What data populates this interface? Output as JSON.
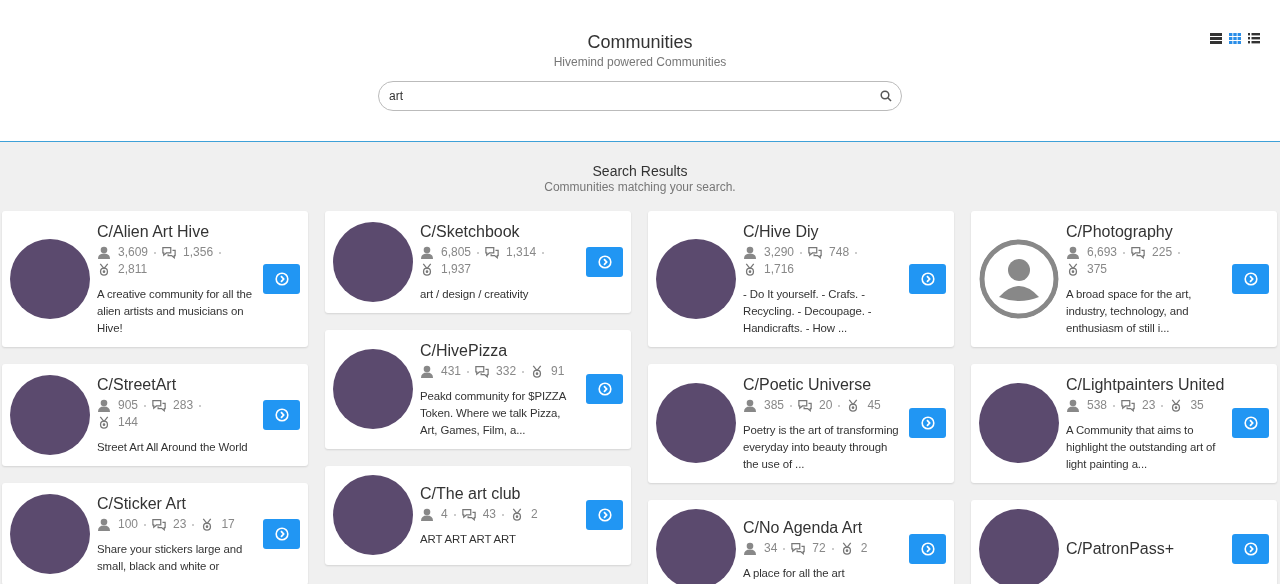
{
  "header": {
    "title": "Communities",
    "subtitle": "Hivemind powered Communities",
    "search": {
      "value": "art"
    },
    "view_modes": [
      {
        "kind": "rows",
        "selected": false
      },
      {
        "kind": "grid",
        "selected": true
      },
      {
        "kind": "list",
        "selected": false
      }
    ]
  },
  "results": {
    "title": "Search Results",
    "subtitle": "Communities matching your search."
  },
  "columns": [
    [
      {
        "name": "C/Alien Art Hive",
        "kind": "photo",
        "members": "3,609",
        "posts": "1,356",
        "authors": "2,811",
        "description": "A creative community for all the alien artists and musicians on Hive!"
      },
      {
        "name": "C/StreetArt",
        "kind": "photo",
        "members": "905",
        "posts": "283",
        "authors": "144",
        "description": "Street Art All Around the World"
      },
      {
        "name": "C/Sticker Art",
        "kind": "photo",
        "members": "100",
        "posts": "23",
        "authors": "17",
        "description": "Share your stickers large and small, black and white or"
      }
    ],
    [
      {
        "name": "C/Sketchbook",
        "kind": "photo",
        "members": "6,805",
        "posts": "1,314",
        "authors": "1,937",
        "description": "art / design / creativity"
      },
      {
        "name": "C/HivePizza",
        "kind": "photo",
        "members": "431",
        "posts": "332",
        "authors": "91",
        "description": "Peakd community for $PIZZA Token. Where we talk Pizza, Art, Games, Film, a..."
      },
      {
        "name": "C/The art club",
        "kind": "photo",
        "members": "4",
        "posts": "43",
        "authors": "2",
        "description": "ART ART ART ART"
      }
    ],
    [
      {
        "name": "C/Hive Diy",
        "kind": "photo",
        "members": "3,290",
        "posts": "748",
        "authors": "1,716",
        "description": "- Do It yourself. - Crafs. - Recycling. - Decoupage. - Handicrafts. - How ..."
      },
      {
        "name": "C/Poetic Universe",
        "kind": "photo",
        "members": "385",
        "posts": "20",
        "authors": "45",
        "description": "Poetry is the art of transforming everyday into beauty through the use of ..."
      },
      {
        "name": "C/No Agenda Art",
        "kind": "photo",
        "members": "34",
        "posts": "72",
        "authors": "2",
        "description": "A place for all the art"
      }
    ],
    [
      {
        "name": "C/Photography",
        "kind": "default",
        "members": "6,693",
        "posts": "225",
        "authors": "375",
        "description": "A broad space for the art, industry, technology, and enthusiasm of still i..."
      },
      {
        "name": "C/Lightpainters United",
        "kind": "photo",
        "members": "538",
        "posts": "23",
        "authors": "35",
        "description": "A Community that aims to highlight the outstanding art of light painting a..."
      },
      {
        "name": "C/PatronPass+",
        "kind": "photo"
      }
    ]
  ]
}
